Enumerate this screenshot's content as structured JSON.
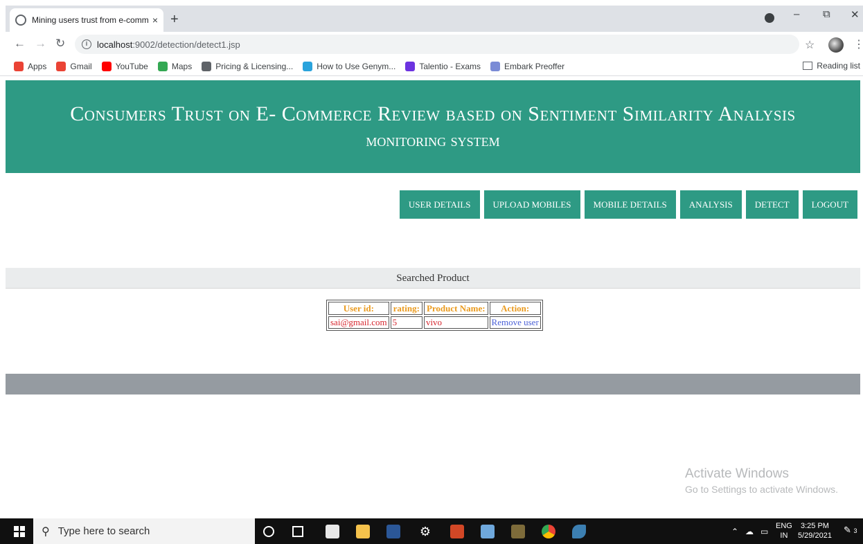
{
  "browser": {
    "tab_title": "Mining users trust from e-comm",
    "close_glyph": "×",
    "new_tab_glyph": "+",
    "url_host": "localhost",
    "url_path": ":9002/detection/detect1.jsp",
    "bookmarks": [
      {
        "label": "Apps",
        "icon": "apps-grid-icon",
        "color": "#ea4335"
      },
      {
        "label": "Gmail",
        "icon": "gmail-icon",
        "color": "#ea4335"
      },
      {
        "label": "YouTube",
        "icon": "youtube-icon",
        "color": "#ff0000"
      },
      {
        "label": "Maps",
        "icon": "maps-pin-icon",
        "color": "#34a853"
      },
      {
        "label": "Pricing & Licensing...",
        "icon": "globe-icon",
        "color": "#5f6368"
      },
      {
        "label": "How to Use Genym...",
        "icon": "genymotion-icon",
        "color": "#2aa3dc"
      },
      {
        "label": "Talentio - Exams",
        "icon": "talentio-icon",
        "color": "#6c33e0"
      },
      {
        "label": "Embark Preoffer",
        "icon": "embark-icon",
        "color": "#7a8bd6"
      }
    ],
    "reading_list": "Reading list"
  },
  "page": {
    "title_line1": "Consumers Trust on E- Commerce Review based on Sentiment Similarity Analysis",
    "title_line2": "monitoring system",
    "menu": [
      "USER DETAILS",
      "UPLOAD MOBILES",
      "MOBILE DETAILS",
      "ANALYSIS",
      "DETECT",
      "LOGOUT"
    ],
    "section_title": "Searched Product",
    "table": {
      "headers": [
        "User id:",
        "rating:",
        "Product Name:",
        "Action:"
      ],
      "rows": [
        {
          "user_id": "sai@gmail.com",
          "rating": "5",
          "product": "vivo",
          "action": "Remove user"
        }
      ]
    },
    "colors": {
      "accent": "#2e9a84",
      "header_text": "#ea9a1e",
      "cell_text": "#d6262e",
      "link": "#4a5fd6"
    }
  },
  "watermark": {
    "line1": "Activate Windows",
    "line2": "Go to Settings to activate Windows."
  },
  "taskbar": {
    "search_placeholder": "Type here to search",
    "lang_top": "ENG",
    "lang_bottom": "IN",
    "time": "3:25 PM",
    "date": "5/29/2021",
    "notifications": "3"
  }
}
